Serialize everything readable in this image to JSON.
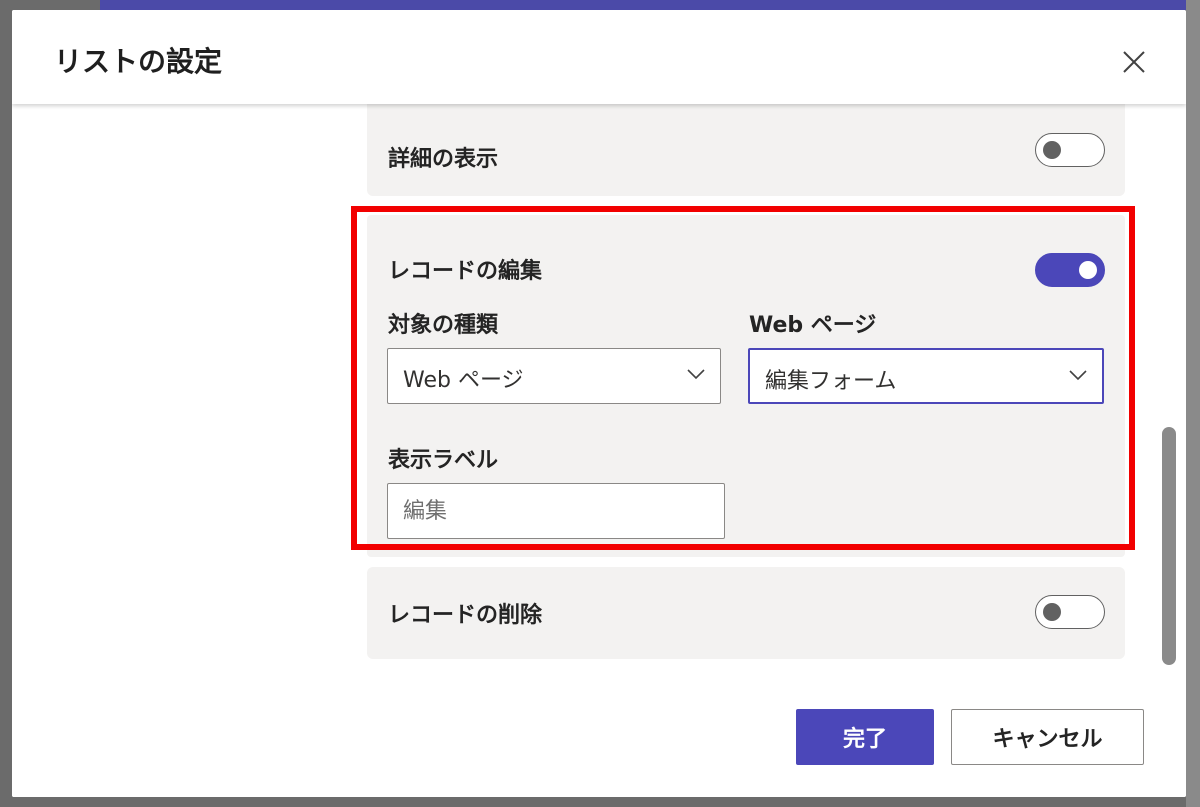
{
  "dialog": {
    "title": "リストの設定",
    "close_icon": "close-icon"
  },
  "settings": {
    "details": {
      "label": "詳細の表示",
      "enabled": false
    },
    "edit_record": {
      "label": "レコードの編集",
      "enabled": true,
      "target_type_label": "対象の種類",
      "target_type_value": "Web ページ",
      "web_page_label": "Web ページ",
      "web_page_value": "編集フォーム",
      "display_label_label": "表示ラベル",
      "display_label_placeholder": "編集"
    },
    "delete_record": {
      "label": "レコードの削除",
      "enabled": false
    }
  },
  "footer": {
    "done_label": "完了",
    "cancel_label": "キャンセル"
  },
  "colors": {
    "accent": "#4b47b9",
    "highlight": "#f20000",
    "card_bg": "#f3f2f1"
  }
}
